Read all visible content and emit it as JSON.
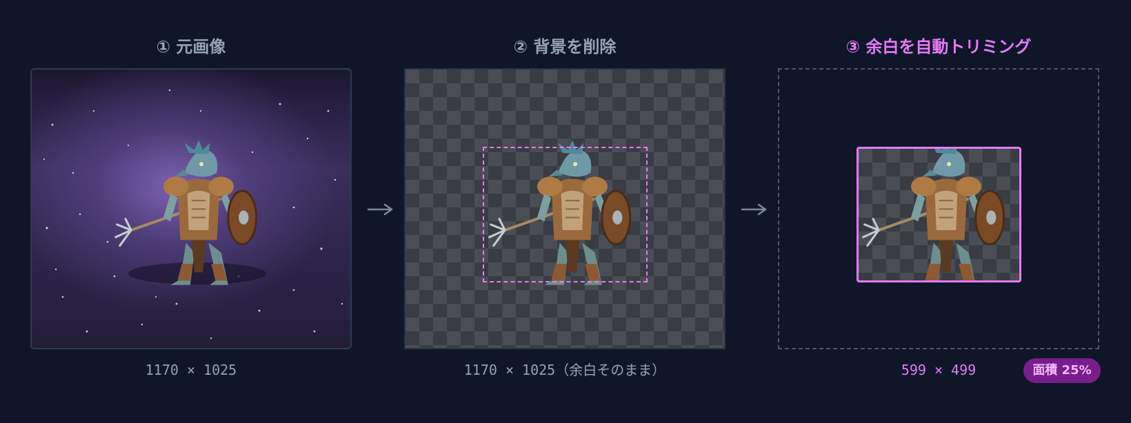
{
  "steps": [
    {
      "title": "① 元画像",
      "dimensions": "1170 × 1025"
    },
    {
      "title": "② 背景を削除",
      "dimensions": "1170 × 1025（余白そのまま）"
    },
    {
      "title": "③ 余白を自動トリミング",
      "dimensions": "599 × 499"
    }
  ],
  "area_badge": "面積 25%",
  "colors": {
    "background": "#0e1628",
    "accent": "#e879f9",
    "muted_text": "#94a3b8",
    "badge_bg": "#7a1d8c"
  },
  "icons": [
    "arrow-right-icon",
    "character-sprite"
  ]
}
